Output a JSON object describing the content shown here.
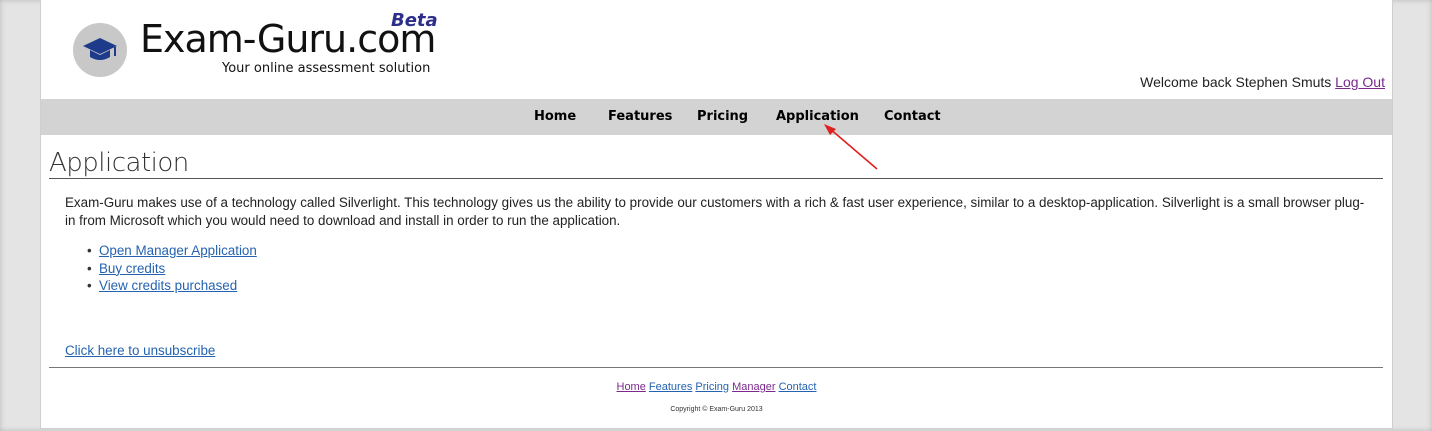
{
  "header": {
    "brand": "Exam-Guru.com",
    "beta": "Beta",
    "tagline": "Your online assessment solution",
    "welcome_text": "Welcome back Stephen Smuts",
    "logout_label": "Log Out",
    "logo_icon": "graduation-cap-icon"
  },
  "nav": {
    "items": [
      {
        "label": "Home"
      },
      {
        "label": "Features"
      },
      {
        "label": "Pricing"
      },
      {
        "label": "Application"
      },
      {
        "label": "Contact"
      }
    ]
  },
  "main": {
    "title": "Application",
    "intro": "Exam-Guru makes use of a technology called Silverlight. This technology gives us the ability to provide our customers with a rich & fast user experience, similar to a desktop-application. Silverlight is a small browser plug-in from Microsoft which you would need to download and install in order to run the application.",
    "links": [
      {
        "label": "Open Manager Application"
      },
      {
        "label": "Buy credits"
      },
      {
        "label": "View credits purchased"
      }
    ],
    "unsubscribe": "Click here to unsubscribe"
  },
  "footer": {
    "links": [
      {
        "label": "Home"
      },
      {
        "label": "Features"
      },
      {
        "label": "Pricing"
      },
      {
        "label": "Manager"
      },
      {
        "label": "Contact"
      }
    ],
    "copyright": "Copyright © Exam-Guru 2013"
  },
  "colors": {
    "nav_bg": "#d3d3d3",
    "link_blue": "#2563b0",
    "link_visited": "#7b2a8c",
    "beta": "#2d2d8a",
    "annotation_arrow": "#e02020"
  }
}
